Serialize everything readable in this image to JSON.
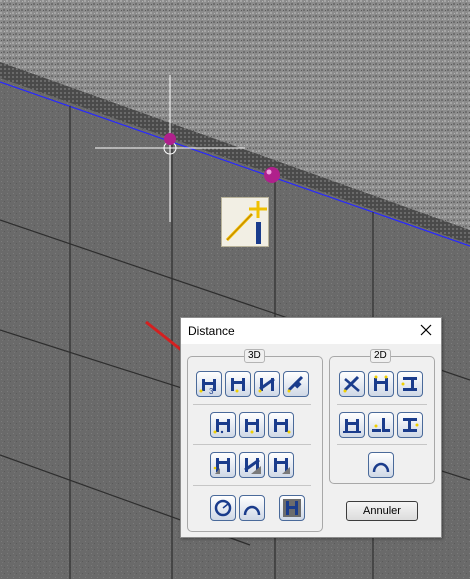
{
  "dialog": {
    "title": "Distance",
    "group_3d": "3D",
    "group_2d": "2D",
    "cancel_label": "Annuler"
  },
  "tools_3d": [
    {
      "icon": "distance-3-points-icon"
    },
    {
      "icon": "distance-parallel-icon"
    },
    {
      "icon": "distance-oblique-icon"
    },
    {
      "icon": "distance-diagonal-icon"
    },
    {
      "icon": "distance-point-left-icon"
    },
    {
      "icon": "distance-point-center-icon"
    },
    {
      "icon": "distance-point-right-icon"
    },
    {
      "icon": "distance-edge-icon"
    },
    {
      "icon": "distance-edge-oblique-icon"
    },
    {
      "icon": "distance-edge-end-icon"
    },
    {
      "icon": "distance-circle-icon"
    },
    {
      "icon": "distance-arc-icon"
    },
    {
      "icon": "distance-vertical-section-icon"
    }
  ],
  "tools_2d": [
    {
      "icon": "distance-2d-diagonal-icon"
    },
    {
      "icon": "distance-2d-parallel-icon"
    },
    {
      "icon": "distance-2d-vertical-icon"
    },
    {
      "icon": "distance-2d-horizontal-icon"
    },
    {
      "icon": "distance-2d-step-icon"
    },
    {
      "icon": "distance-2d-vertical-alt-icon"
    },
    {
      "icon": "distance-2d-arc-icon"
    }
  ],
  "colors": {
    "tool_blue": "#1a3c8c",
    "tool_yellow": "#f0d000",
    "arrow_red": "#d42020",
    "edge_line_blue": "#2828ff",
    "snap_magenta": "#b0208c"
  }
}
